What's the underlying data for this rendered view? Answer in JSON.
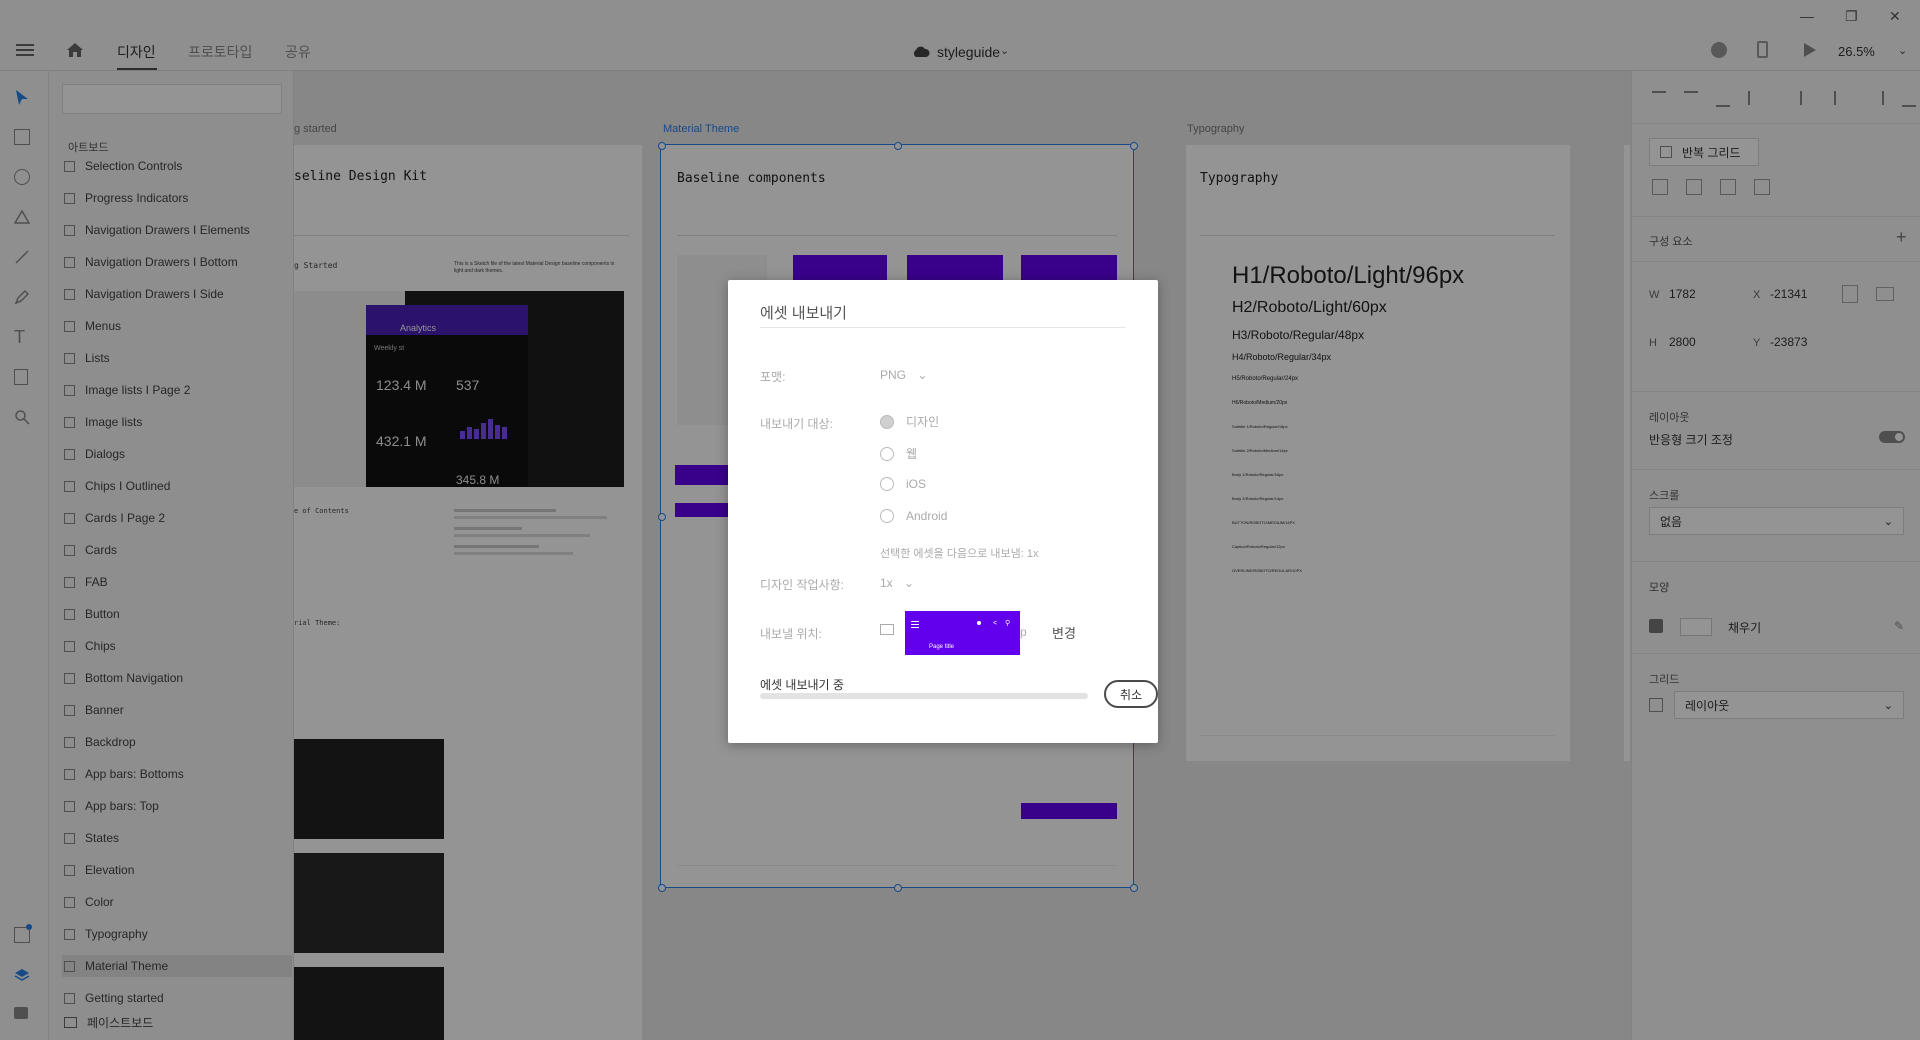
{
  "app": {
    "tabs": [
      "디자인",
      "프로토타입",
      "공유"
    ],
    "doc_title": "styleguide",
    "zoom": "26.5%"
  },
  "layers": {
    "section_label": "아트보드",
    "items": [
      "Selection Controls",
      "Progress Indicators",
      "Navigation Drawers I Elements",
      "Navigation Drawers I Bottom",
      "Navigation Drawers I Side",
      "Menus",
      "Lists",
      "Image lists I Page 2",
      "Image lists",
      "Dialogs",
      "Chips I Outlined",
      "Cards I Page 2",
      "Cards",
      "FAB",
      "Button",
      "Chips",
      "Bottom Navigation",
      "Banner",
      "Backdrop",
      "App bars: Bottoms",
      "App bars: Top",
      "States",
      "Elevation",
      "Color",
      "Typography",
      "Material Theme",
      "Getting started"
    ],
    "pasteboard": "페이스트보드",
    "selected": "Material Theme"
  },
  "canvas": {
    "labels": {
      "getting_started": "g started",
      "material_theme": "Material Theme",
      "typography": "Typography"
    },
    "ab1": {
      "title": "seline Design Kit",
      "subtitle": "g Started",
      "intro": "This is a Sketch file of the latest Material Design baseline components in light and dark themes.",
      "toc": "e of Contents",
      "theme": "rial Theme:",
      "analytics_title": "Analytics",
      "weekly": "Weekly st",
      "m1": "123.4 M",
      "m2": "537",
      "m3": "432.1 M",
      "m4": "345.8 M"
    },
    "ab2": {
      "title": "Baseline components",
      "page_title": "Page title"
    },
    "ab3": {
      "title": "Typography",
      "h1": "H1/Roboto/Light/96px",
      "h2": "H2/Roboto/Light/60px",
      "h3": "H3/Roboto/Regular/48px",
      "h4": "H4/Roboto/Regular/34px",
      "h5": "H5/Roboto/Regular/24px",
      "h6": "H6/Roboto/Medium/20px",
      "s1": "Subtitle 1/Roboto/Regular/16px",
      "s2": "Subtitle 2/Roboto/Medium/14px",
      "b1": "Body 1/Roboto/Regular/16px",
      "b2": "Body 2/Roboto/Regular/14px",
      "btn": "BUTTON/ROBOTO/MEDIUM/14PX",
      "cap": "Caption/Roboto/Regular/12px",
      "over": "OVERLINE/ROBOTO/REGULAR/10PX"
    }
  },
  "props": {
    "repeat_grid": "반복 그리드",
    "components": "구성 요소",
    "w_label": "W",
    "w": "1782",
    "x_label": "X",
    "x": "-21341",
    "h_label": "H",
    "h": "2800",
    "y_label": "Y",
    "y": "-23873",
    "layout": "레이아웃",
    "responsive": "반응형 크기 조정",
    "scroll": "스크롤",
    "scroll_value": "없음",
    "appearance": "모양",
    "fill": "채우기",
    "grid": "그리드",
    "grid_value": "레이아웃"
  },
  "dialog": {
    "title": "에셋 내보내기",
    "format_label": "포맷:",
    "format_value": "PNG",
    "target_label": "내보내기 대상:",
    "targets": [
      "디자인",
      "웹",
      "iOS",
      "Android"
    ],
    "export_note": "선택한 에셋을 다음으로 내보냄: 1x",
    "design_label": "디자인 작업사항:",
    "design_value": "1x",
    "location_label": "내보낼 위치:",
    "location_suffix": "p",
    "change": "변경",
    "progress_label": "에셋 내보내기 중",
    "progress": 0.0,
    "cancel": "취소",
    "thumb_title": "Page title"
  },
  "colors": {
    "accent": "#6200ee",
    "selection": "#2680eb"
  }
}
